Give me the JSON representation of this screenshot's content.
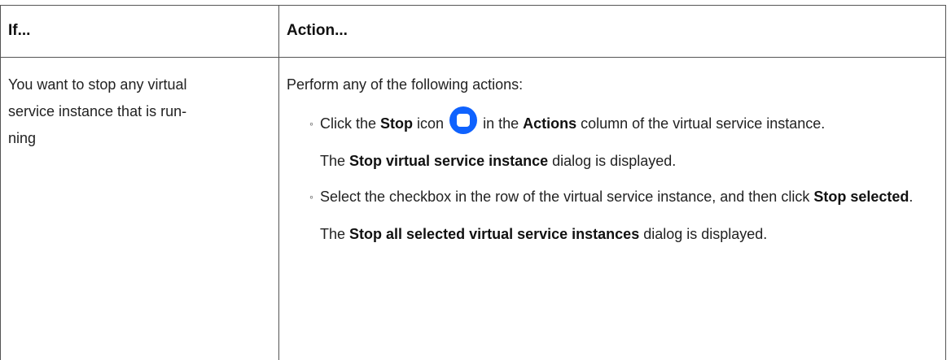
{
  "header": {
    "col1": "If...",
    "col2": "Action..."
  },
  "row": {
    "condition": "You want to stop any virtual service instance that is run-ning",
    "condition_lines": [
      "You want to stop any virtual",
      "service instance that is run-",
      "ning"
    ],
    "intro": "Perform any of the following actions:",
    "item1": {
      "bullet": "◦",
      "pre": "Click the ",
      "stop": "Stop",
      "mid": " icon ",
      "icon": "stop-circle-icon",
      "post1": " in the ",
      "actions": "Actions",
      "post2": " column of the virtual service instance."
    },
    "note1": {
      "pre": "The ",
      "bold": "Stop virtual service instance",
      "post": " dialog is displayed."
    },
    "item2": {
      "bullet": "◦",
      "pre": "Select the checkbox in the row of the virtual service instance, and then click ",
      "bold": "Stop selected",
      "post": "."
    },
    "note2": {
      "pre": "The ",
      "bold": "Stop all selected virtual service instances",
      "post": " dialog is displayed."
    }
  },
  "colors": {
    "icon_blue": "#0f62fe",
    "border": "#555555",
    "text": "#222222"
  }
}
